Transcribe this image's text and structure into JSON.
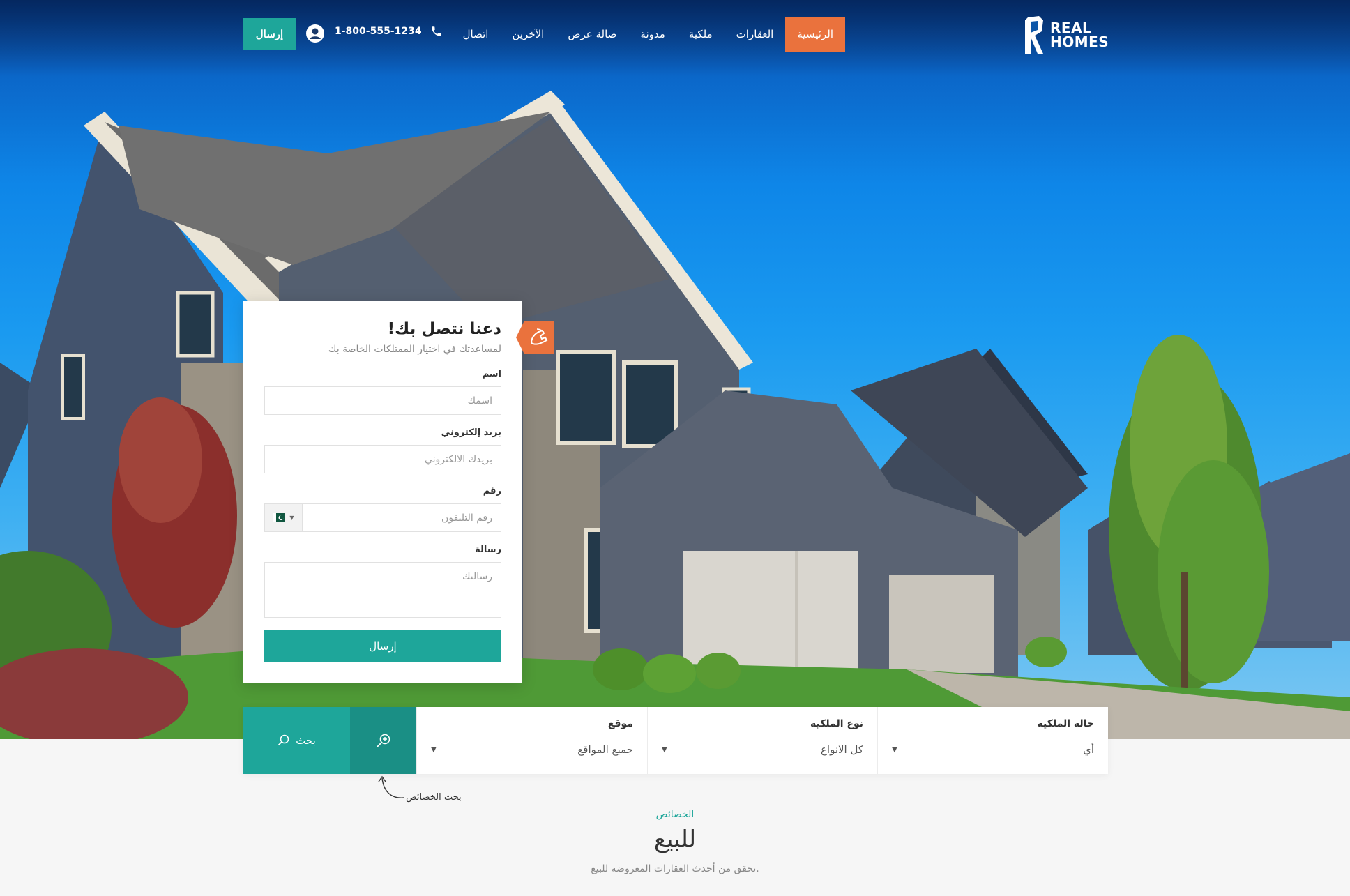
{
  "brand": {
    "line1": "REAL",
    "line2": "HOMES"
  },
  "nav": [
    {
      "label": "الرئيسية",
      "active": true
    },
    {
      "label": "العقارات"
    },
    {
      "label": "ملكية"
    },
    {
      "label": "مدونة"
    },
    {
      "label": "صالة عرض"
    },
    {
      "label": "الآخرين"
    },
    {
      "label": "اتصال"
    }
  ],
  "header": {
    "phone": "1-800-555-1234",
    "submit_label": "إرسال"
  },
  "form": {
    "title": "دعنا نتصل بك!",
    "subtitle": "لمساعدتك في اختيار الممتلكات الخاصة بك",
    "name_label": "اسم",
    "name_placeholder": "اسمك",
    "email_label": "بريد إلكتروني",
    "email_placeholder": "بريدك الالكتروني",
    "phone_label": "رقم",
    "phone_placeholder": "رقم التليفون",
    "message_label": "رسالة",
    "message_placeholder": "رسالتك",
    "send_label": "إرسال"
  },
  "search": {
    "status_label": "حالة الملكية",
    "status_value": "أي",
    "type_label": "نوع الملكية",
    "type_value": "كل الانواع",
    "location_label": "موقع",
    "location_value": "جميع المواقع",
    "search_label": "بحث",
    "advanced_note": "بحث الخصائص"
  },
  "section": {
    "tag": "الخصائص",
    "title": "للبيع",
    "description": "تحقق من أحدث العقارات المعروضة للبيع."
  },
  "colors": {
    "accent": "#1ea69a",
    "accent_dark": "#1a8f85",
    "nav_active": "#ea723d"
  }
}
